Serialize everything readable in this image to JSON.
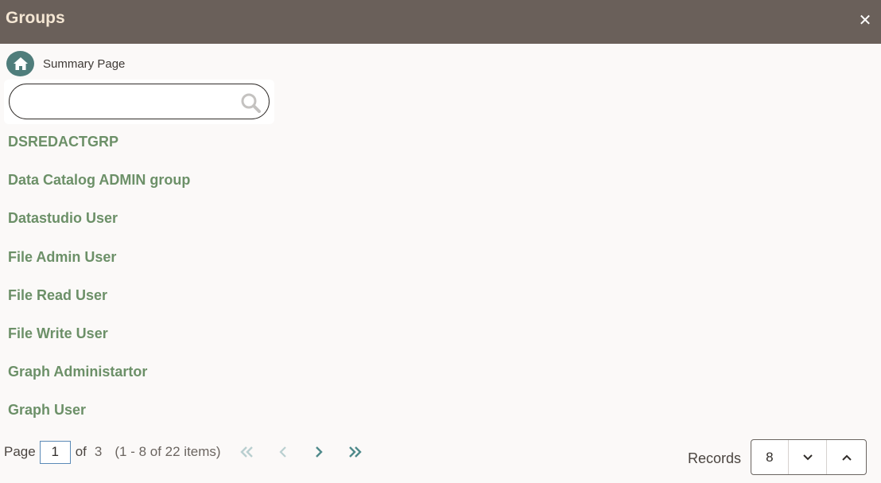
{
  "header": {
    "title": "Groups",
    "close_glyph": "✕"
  },
  "breadcrumb": {
    "home_icon": "home-icon",
    "label": "Summary Page"
  },
  "search": {
    "value": "",
    "placeholder": "",
    "icon": "search-icon"
  },
  "groups": [
    "DSREDACTGRP",
    "Data Catalog ADMIN group",
    "Datastudio User",
    "File Admin User",
    "File Read User",
    "File Write User",
    "Graph Administartor",
    "Graph User"
  ],
  "pager": {
    "page_label": "Page",
    "current_page": "1",
    "of_label": "of",
    "total_pages": "3",
    "items_summary": "(1 - 8 of 22 items)"
  },
  "records": {
    "label": "Records",
    "value": "8"
  },
  "colors": {
    "header_bg": "#6a605a",
    "header_title": "#f4e6d3",
    "link_green": "#6c9068",
    "home_teal": "#4f7d7b",
    "nav_teal": "#4f8a8b"
  }
}
